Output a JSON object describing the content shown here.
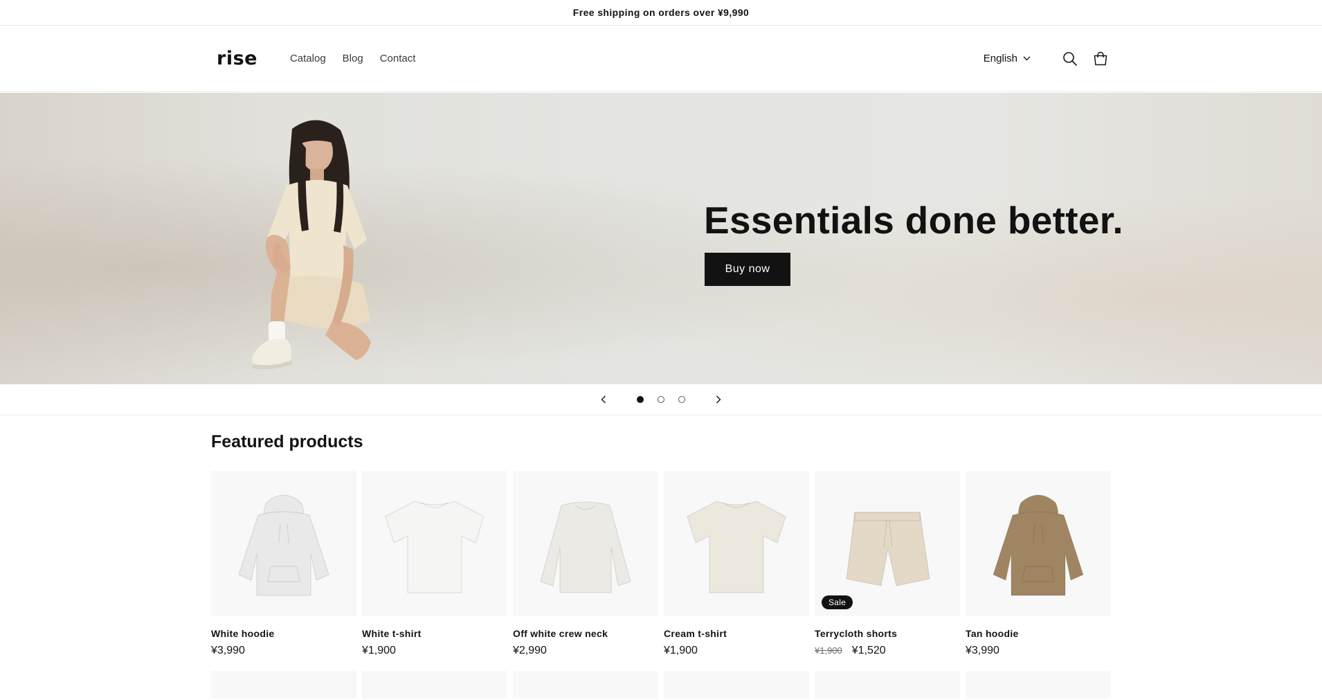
{
  "announcement": {
    "text": "Free shipping on orders over ¥9,990"
  },
  "header": {
    "logo": "rise",
    "nav": [
      "Catalog",
      "Blog",
      "Contact"
    ],
    "language": "English"
  },
  "hero": {
    "heading": "Essentials done better.",
    "button": "Buy now"
  },
  "slider": {
    "total": 3,
    "active_index": 0
  },
  "featured": {
    "title": "Featured products",
    "products": [
      {
        "name": "White hoodie",
        "price": "¥3,990",
        "old_price": "",
        "badge": "",
        "item": "hoodie",
        "color": "#e9e9e9"
      },
      {
        "name": "White t-shirt",
        "price": "¥1,900",
        "old_price": "",
        "badge": "",
        "item": "tshirt",
        "color": "#f5f5f4"
      },
      {
        "name": "Off white crew neck",
        "price": "¥2,990",
        "old_price": "",
        "badge": "",
        "item": "sweatshirt",
        "color": "#eceae4"
      },
      {
        "name": "Cream t-shirt",
        "price": "¥1,900",
        "old_price": "",
        "badge": "",
        "item": "tshirt",
        "color": "#ede8dd"
      },
      {
        "name": "Terrycloth shorts",
        "price": "¥1,520",
        "old_price": "¥1,900",
        "badge": "Sale",
        "item": "shorts",
        "color": "#e3d9c6"
      },
      {
        "name": "Tan hoodie",
        "price": "¥3,990",
        "old_price": "",
        "badge": "",
        "item": "hoodie",
        "color": "#a08563"
      }
    ]
  },
  "colors": {
    "text": "#121212",
    "button": "#121212",
    "hero_bg": "#e4e5e1",
    "card_bg": "#f8f8f8"
  }
}
